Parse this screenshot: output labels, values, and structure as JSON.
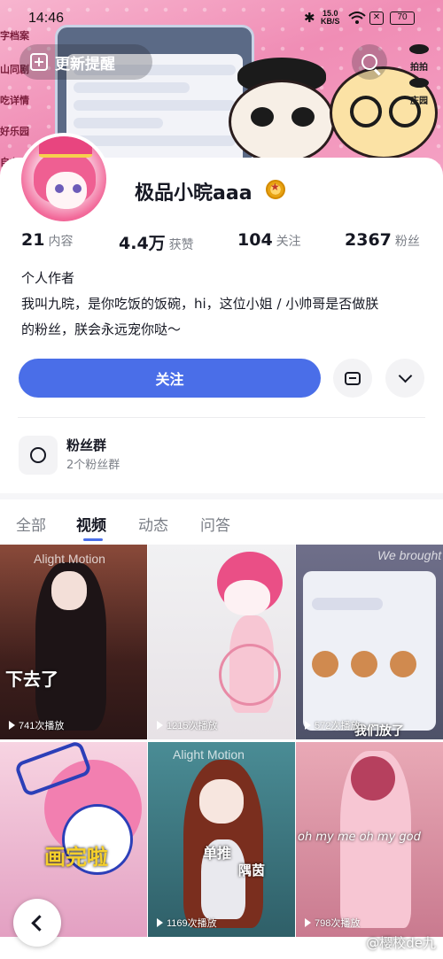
{
  "status_bar": {
    "time": "14:46",
    "network_speed_value": "15.0",
    "network_speed_unit": "KB/S",
    "battery": "70"
  },
  "header": {
    "notify_label": "更新提醒",
    "side_labels": [
      "字档案",
      "山同剧",
      "吃详情",
      "好乐园",
      "自在"
    ],
    "right_labels": [
      "拍拍",
      "庄园"
    ]
  },
  "profile": {
    "username": "极品小晥aaa",
    "stats": [
      {
        "value": "21",
        "label": "内容"
      },
      {
        "value": "4.4万",
        "label": "获赞"
      },
      {
        "value": "104",
        "label": "关注"
      },
      {
        "value": "2367",
        "label": "粉丝"
      }
    ],
    "bio_lines": [
      "个人作者",
      "我叫九晥，是你吃饭的饭碗，hi，这位小姐 / 小帅哥是否做朕",
      "的粉丝，朕会永远宠你哒～"
    ],
    "follow_label": "关注"
  },
  "fan_group": {
    "title": "粉丝群",
    "subtitle": "2个粉丝群"
  },
  "tabs": [
    {
      "label": "全部",
      "active": false
    },
    {
      "label": "视频",
      "active": true
    },
    {
      "label": "动态",
      "active": false
    },
    {
      "label": "问答",
      "active": false
    }
  ],
  "videos": [
    {
      "plays": "741次播放",
      "overlay": "下去了",
      "watermark": "Alight Motion"
    },
    {
      "plays": "1215次播放",
      "overlay": "",
      "watermark": ""
    },
    {
      "plays": "572次播放",
      "overlay": "我们放了",
      "watermark": "We brought"
    },
    {
      "plays": "",
      "overlay": "画完啦",
      "watermark": ""
    },
    {
      "plays": "1169次播放",
      "overlay": "单推",
      "overlay2": "隅茵",
      "watermark": "Alight Motion"
    },
    {
      "plays": "798次播放",
      "overlay": "oh my me oh my god",
      "watermark": ""
    }
  ],
  "footer_watermark": "@樱校de九",
  "colors": {
    "accent": "#4a6ee8",
    "text_primary": "#161823",
    "text_secondary": "#7b7f87",
    "banner": "#f08db5"
  },
  "icons": {
    "notify": "plus-square-icon",
    "search": "search-icon",
    "message": "message-icon",
    "dropdown": "chevron-down-icon",
    "fan_group": "people-icon",
    "back": "chevron-left-icon"
  }
}
